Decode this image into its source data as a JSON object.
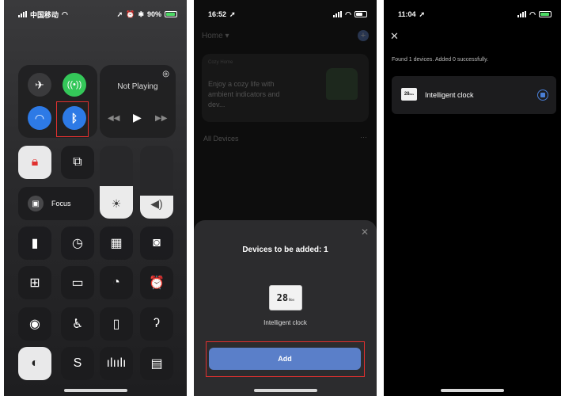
{
  "colors": {
    "accent": "#5a7fc9",
    "highlight": "#e0302f",
    "green": "#4cd964",
    "bluetooth": "#2d7ae6"
  },
  "panel1": {
    "status": {
      "carrier": "中国移动",
      "battery": "90%"
    },
    "now_playing": "Not Playing",
    "focus_label": "Focus",
    "icons": [
      "airplane-mode-icon",
      "cellular-data-icon",
      "wifi-icon",
      "bluetooth-icon",
      "airplay-icon",
      "rewind-icon",
      "play-icon",
      "fast-forward-icon",
      "orientation-lock-icon",
      "screen-mirroring-icon",
      "brightness-icon",
      "volume-icon",
      "focus-icon",
      "flashlight-icon",
      "timer-icon",
      "calculator-icon",
      "camera-icon",
      "qr-scanner-icon",
      "low-power-mode-icon",
      "stopwatch-icon",
      "alarm-icon",
      "screen-record-icon",
      "accessibility-icon",
      "apple-tv-remote-icon",
      "hearing-icon",
      "dark-mode-icon",
      "shazam-icon",
      "sound-recognition-icon",
      "quick-note-icon"
    ]
  },
  "panel2": {
    "status": {
      "time": "16:52"
    },
    "home_label": "Home",
    "banner_tag": "Cozy Home",
    "banner_text": "Enjoy a cozy life with ambient indicators and dev...",
    "all_devices": "All Devices",
    "more": "···",
    "sheet_title": "Devices to be added: 1",
    "device_name": "Intelligent clock",
    "clock_display": "28",
    "clock_unit": "Nov",
    "add_button": "Add"
  },
  "panel3": {
    "status": {
      "time": "11:04"
    },
    "found_text": "Found 1 devices. Added 0 successfully.",
    "device_name": "Intelligent clock",
    "clock_display": "28",
    "clock_unit": "Nov"
  }
}
